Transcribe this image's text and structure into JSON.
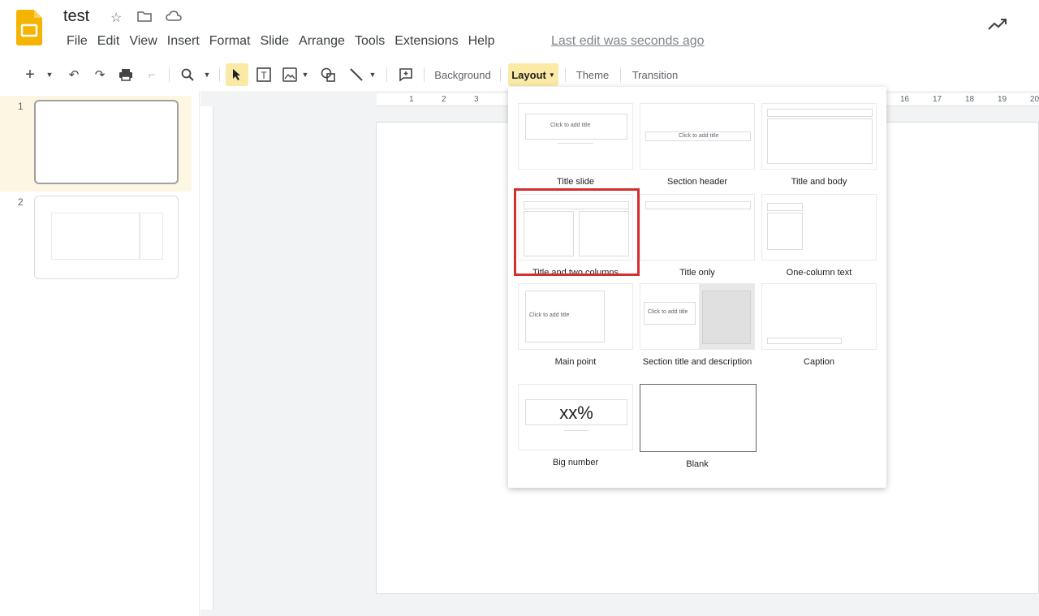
{
  "app": {
    "doc_title": "test",
    "menu": [
      "File",
      "Edit",
      "View",
      "Insert",
      "Format",
      "Slide",
      "Arrange",
      "Tools",
      "Extensions",
      "Help"
    ],
    "last_edit": "Last edit was seconds ago",
    "brand_color": "#f4b400"
  },
  "toolbar": {
    "background_label": "Background",
    "layout_label": "Layout",
    "theme_label": "Theme",
    "transition_label": "Transition"
  },
  "filmstrip": {
    "slides": [
      {
        "number": "1",
        "selected": true
      },
      {
        "number": "2",
        "selected": false
      }
    ]
  },
  "ruler": {
    "top_ticks": [
      "1",
      "2",
      "3",
      "16",
      "17",
      "18",
      "19",
      "20"
    ]
  },
  "layout_menu": {
    "options": [
      {
        "label": "Title slide",
        "placeholder": "Click to add title"
      },
      {
        "label": "Section header",
        "placeholder": "Click to add title"
      },
      {
        "label": "Title and body",
        "placeholder": ""
      },
      {
        "label": "Title and two columns",
        "placeholder": "",
        "highlighted": true
      },
      {
        "label": "Title only",
        "placeholder": ""
      },
      {
        "label": "One-column text",
        "placeholder": ""
      },
      {
        "label": "Main point",
        "placeholder": "Click to add title"
      },
      {
        "label": "Section title and description",
        "placeholder": "Click to add title"
      },
      {
        "label": "Caption",
        "placeholder": ""
      },
      {
        "label": "Big number",
        "placeholder": "xx%"
      },
      {
        "label": "Blank",
        "placeholder": ""
      }
    ],
    "highlight_color": "#d32f2f"
  }
}
